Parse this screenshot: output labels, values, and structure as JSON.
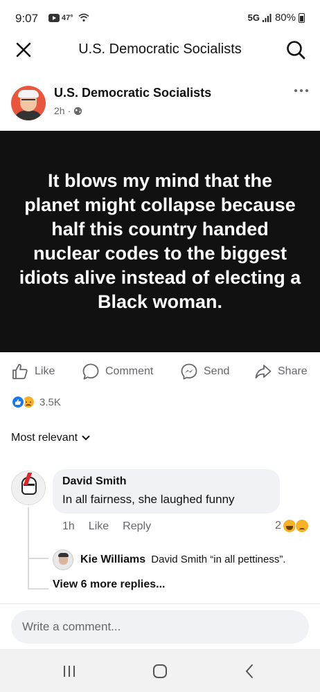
{
  "status_bar": {
    "time": "9:07",
    "temperature": "47°",
    "network": "5G",
    "battery": "80%"
  },
  "header": {
    "title": "U.S. Democratic Socialists",
    "close_icon": "close-icon",
    "search_icon": "search-icon"
  },
  "post": {
    "page_name": "U.S. Democratic Socialists",
    "time": "2h",
    "separator": "·",
    "privacy_icon": "globe-icon",
    "image_text": "It blows my mind that the planet might collapse because half this country handed nuclear codes to the biggest idiots alive instead of electing a Black woman.",
    "image_bg": "#111111"
  },
  "actions": {
    "like": "Like",
    "comment": "Comment",
    "send": "Send",
    "share": "Share"
  },
  "reactions": {
    "count": "3.5K",
    "types": [
      "like",
      "sad"
    ]
  },
  "sort": {
    "label": "Most relevant"
  },
  "comment": {
    "author": "David Smith",
    "text": "In all fairness, she laughed funny",
    "time": "1h",
    "like": "Like",
    "reply": "Reply",
    "reaction_count": "2",
    "reaction_types": [
      "haha",
      "sad"
    ]
  },
  "reply": {
    "author": "Kie Williams",
    "text": "David Smith “in all pettiness”."
  },
  "view_more": "View 6 more replies...",
  "composer": {
    "placeholder": "Write a comment..."
  },
  "nav": {
    "recent": "recent-apps-icon",
    "home": "home-icon",
    "back": "back-icon"
  },
  "colors": {
    "accent": "#1877f2",
    "muted_text": "#65676b",
    "bubble_bg": "#f0f2f5"
  }
}
